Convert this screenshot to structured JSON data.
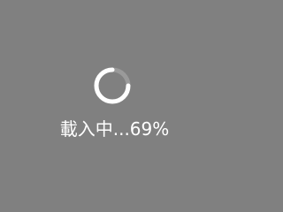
{
  "loading": {
    "text": "載入中...69%",
    "progress": 0.69,
    "spinner_icon": "loading-spinner-icon"
  },
  "colors": {
    "background": "#808080",
    "spinner_arc": "#ffffff",
    "spinner_track": "#9a9a9a",
    "text": "#ffffff"
  }
}
